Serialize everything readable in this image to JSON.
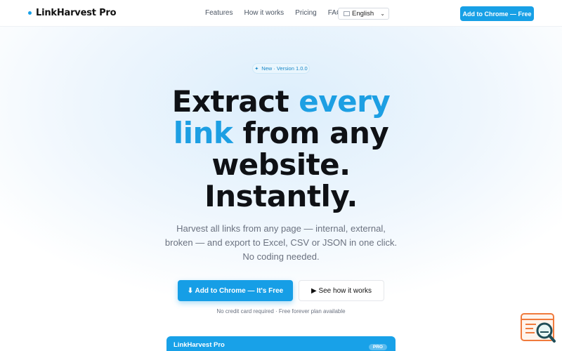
{
  "nav": {
    "logo": "LinkHarvest Pro",
    "links": [
      "Features",
      "How it works",
      "Pricing",
      "FAQ"
    ],
    "language": "English",
    "cta": "Add to Chrome — Free"
  },
  "hero": {
    "badge_text": "New · Version 1.0.0",
    "title_line1_a": "Extract ",
    "title_line1_b": "every",
    "title_line2_a": "link",
    "title_line2_b": " from any",
    "title_line3": "website.",
    "title_line4": "Instantly.",
    "subtitle": "Harvest all links from any page — internal, external, broken — and export to Excel, CSV or JSON in one click. No coding needed.",
    "cta_primary": "⬇ Add to Chrome — It's Free",
    "cta_secondary": "▶ See how it works",
    "note": "No credit card required · Free forever plan available"
  },
  "preview": {
    "title": "LinkHarvest Pro",
    "pro_badge": "PRO"
  },
  "colors": {
    "accent": "#1d9fe3",
    "floating_widget": "#f07a3c"
  },
  "icons": {
    "badge": "sparkle-icon",
    "flag": "flag-icon",
    "floating": "search-analytics-icon"
  }
}
